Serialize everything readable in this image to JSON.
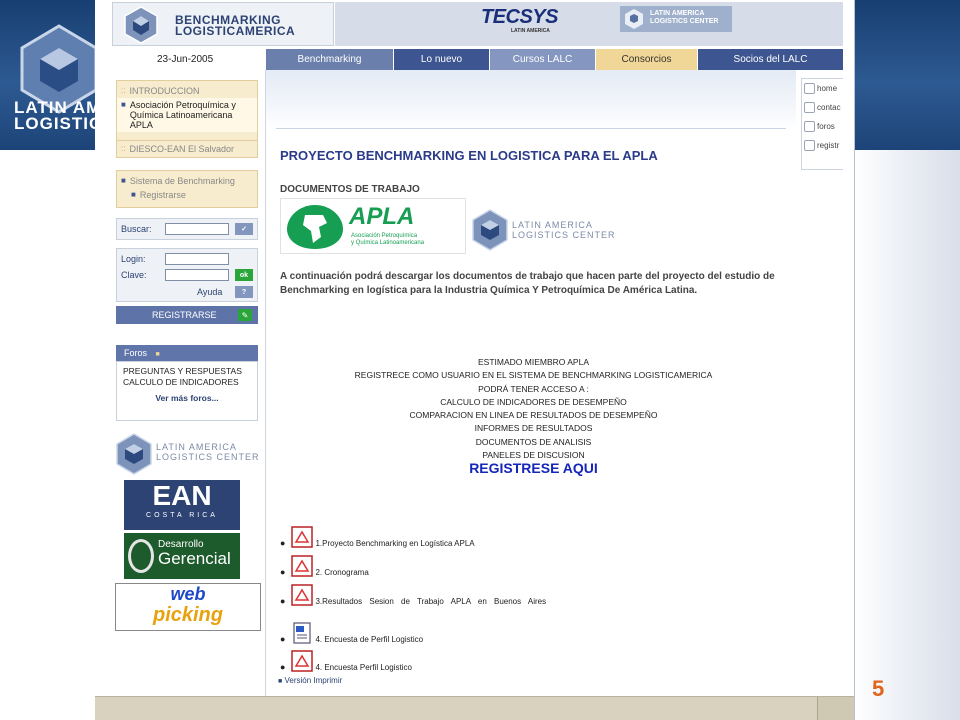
{
  "slide": {
    "logo_text_line1": "LATIN AM",
    "logo_text_line2": "LOGISTIC",
    "page_number": "5"
  },
  "header": {
    "brand_line1": "BENCHMARKING",
    "brand_line2": "LOGISTICAMERICA",
    "partner_name": "TECSYS",
    "partner_sub": "LATIN AMERICA",
    "lalc_line1": "LATIN AMERICA",
    "lalc_line2": "LOGISTICS CENTER",
    "date": "23-Jun-2005"
  },
  "nav": {
    "items": [
      {
        "label": "Benchmarking",
        "color": "#6b7fac"
      },
      {
        "label": "Lo nuevo",
        "color": "#3d5590"
      },
      {
        "label": "Cursos LALC",
        "color": "#8597c0"
      },
      {
        "label": "Consorcios",
        "color": "#f1d797"
      },
      {
        "label": "Socios del LALC",
        "color": "#3d5590"
      }
    ]
  },
  "sidebar": {
    "section1": {
      "item1": "INTRODUCCION",
      "item2": "Asociación Petroquímica y Química Latinoamericana APLA",
      "item3": "DIESCO-EAN El Salvador"
    },
    "section2": {
      "item1": "Sistema de Benchmarking",
      "item2": "Registrarse"
    },
    "search_label": "Buscar:",
    "login_label": "Login:",
    "password_label": "Clave:",
    "ok_label": "ok",
    "help_label": "Ayuda",
    "help_icon": "?",
    "register_label": "REGISTRARSE",
    "forums_title": "Foros",
    "forums_text": "PREGUNTAS Y RESPUESTAS CALCULO DE INDICADORES",
    "forums_link": "Ver más foros...",
    "lalc_line1": "LATIN AMERICA",
    "lalc_line2": "LOGISTICS CENTER",
    "ean_text": "EAN",
    "ean_sub": "COSTA RICA",
    "dg_line1": "Desarrollo",
    "dg_line2": "Gerencial",
    "wp_line1": "web",
    "wp_line2": "picking"
  },
  "main": {
    "title": "PROYECTO BENCHMARKING EN LOGISTICA PARA EL APLA",
    "subtitle": "DOCUMENTOS DE TRABAJO",
    "apla_logo": "APLA",
    "apla_logo_sub1": "Asociación Petroquímica",
    "apla_logo_sub2": "y Química Latinoamericana",
    "lalc_line1": "LATIN AMERICA",
    "lalc_line2": "LOGISTICS CENTER",
    "intro": "A continuación podrá descargar los documentos de trabajo que hacen parte del proyecto del estudio de Benchmarking en logística para la Industria Química Y Petroquímica De América Latina.",
    "notice": [
      "ESTIMADO MIEMBRO APLA",
      "REGISTRECE COMO USUARIO EN EL SISTEMA DE BENCHMARKING LOGISTICAMERICA",
      "PODRÁ TENER ACCESO A :",
      "CALCULO DE INDICADORES DE DESEMPEÑO",
      "COMPARACION EN LINEA DE RESULTADOS DE DESEMPEÑO",
      "INFORMES DE RESULTADOS",
      "DOCUMENTOS DE ANALISIS",
      "PANELES DE DISCUSION"
    ],
    "register_link": "REGISTRESE AQUI",
    "documents": [
      "1.Proyecto Benchmarking en Logística APLA",
      "2. Cronograma",
      "3.Resultados Sesion de Trabajo APLA en Buenos Aires",
      "4. Encuesta de Perfil Logistico",
      "4. Encuesta Perfil Logistico"
    ],
    "print_link": "Versión Imprimir"
  },
  "right_panel": {
    "items": [
      "home",
      "contac",
      "foros",
      "registr"
    ]
  }
}
